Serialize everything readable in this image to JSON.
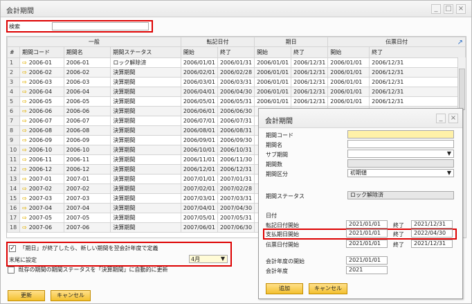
{
  "window": {
    "title": "会計期間",
    "minimize": "_",
    "maximize": "□",
    "close": "×"
  },
  "search": {
    "label": "検索",
    "value": ""
  },
  "grid": {
    "groups": [
      "一般",
      "転記日付",
      "期日",
      "伝票日付"
    ],
    "headers": [
      "#",
      "期間コード",
      "期間名",
      "期間ステータス",
      "開始",
      "終了",
      "開始",
      "終了",
      "開始",
      "終了"
    ],
    "rows": [
      [
        "1",
        "2006-01",
        "2006-01",
        "ロック解除済",
        "2006/01/01",
        "2006/01/31",
        "2006/01/01",
        "2006/12/31",
        "2006/01/01",
        "2006/12/31"
      ],
      [
        "2",
        "2006-02",
        "2006-02",
        "決算期間",
        "2006/02/01",
        "2006/02/28",
        "2006/01/01",
        "2006/12/31",
        "2006/01/01",
        "2006/12/31"
      ],
      [
        "3",
        "2006-03",
        "2006-03",
        "決算期間",
        "2006/03/01",
        "2006/03/31",
        "2006/01/01",
        "2006/12/31",
        "2006/01/01",
        "2006/12/31"
      ],
      [
        "4",
        "2006-04",
        "2006-04",
        "決算期間",
        "2006/04/01",
        "2006/04/30",
        "2006/01/01",
        "2006/12/31",
        "2006/01/01",
        "2006/12/31"
      ],
      [
        "5",
        "2006-05",
        "2006-05",
        "決算期間",
        "2006/05/01",
        "2006/05/31",
        "2006/01/01",
        "2006/12/31",
        "2006/01/01",
        "2006/12/31"
      ],
      [
        "6",
        "2006-06",
        "2006-06",
        "決算期間",
        "2006/06/01",
        "2006/06/30",
        "",
        "",
        "",
        ""
      ],
      [
        "7",
        "2006-07",
        "2006-07",
        "決算期間",
        "2006/07/01",
        "2006/07/31",
        "",
        "",
        "",
        ""
      ],
      [
        "8",
        "2006-08",
        "2006-08",
        "決算期間",
        "2006/08/01",
        "2006/08/31",
        "",
        "",
        "",
        ""
      ],
      [
        "9",
        "2006-09",
        "2006-09",
        "決算期間",
        "2006/09/01",
        "2006/09/30",
        "",
        "",
        "",
        ""
      ],
      [
        "10",
        "2006-10",
        "2006-10",
        "決算期間",
        "2006/10/01",
        "2006/10/31",
        "",
        "",
        "",
        ""
      ],
      [
        "11",
        "2006-11",
        "2006-11",
        "決算期間",
        "2006/11/01",
        "2006/11/30",
        "",
        "",
        "",
        ""
      ],
      [
        "12",
        "2006-12",
        "2006-12",
        "決算期間",
        "2006/12/01",
        "2006/12/31",
        "",
        "",
        "",
        ""
      ],
      [
        "13",
        "2007-01",
        "2007-01",
        "決算期間",
        "2007/01/01",
        "2007/01/31",
        "",
        "",
        "",
        ""
      ],
      [
        "14",
        "2007-02",
        "2007-02",
        "決算期間",
        "2007/02/01",
        "2007/02/28",
        "",
        "",
        "",
        ""
      ],
      [
        "15",
        "2007-03",
        "2007-03",
        "決算期間",
        "2007/03/01",
        "2007/03/31",
        "",
        "",
        "",
        ""
      ],
      [
        "16",
        "2007-04",
        "2007-04",
        "決算期間",
        "2007/04/01",
        "2007/04/30",
        "",
        "",
        "",
        ""
      ],
      [
        "17",
        "2007-05",
        "2007-05",
        "決算期間",
        "2007/05/01",
        "2007/05/31",
        "",
        "",
        "",
        ""
      ],
      [
        "18",
        "2007-06",
        "2007-06",
        "決算期間",
        "2007/06/01",
        "2007/06/30",
        "",
        "",
        "",
        ""
      ]
    ]
  },
  "options": {
    "opt1": "「期日」が終了したら、新しい期間を翌会計年度で定義",
    "opt2_label": "末尾に設定",
    "opt2_value": "4月",
    "opt3": "既存の期間の期間ステータスを「決算期間」に自動的に更新"
  },
  "buttons": {
    "update": "更新",
    "cancel": "キャンセル"
  },
  "dialog": {
    "title": "会計期間",
    "minimize": "_",
    "close": "×",
    "labels": {
      "code": "期間コード",
      "name": "期間名",
      "subperiod": "サブ期間",
      "count": "期間数",
      "category": "期間区分",
      "status": "期間ステータス",
      "dates": "日付",
      "posting": "転記日付開始",
      "due": "支払期日開始",
      "doc": "伝票日付開始",
      "fy_start": "会計年度の開始",
      "fy": "会計年度",
      "end": "終了"
    },
    "values": {
      "category": "初期値",
      "status": "ロック解除済",
      "posting_from": "2021/01/01",
      "posting_to": "2021/12/31",
      "due_from": "2021/01/01",
      "due_to": "2022/04/30",
      "doc_from": "2021/01/01",
      "doc_to": "2021/12/31",
      "fy_start": "2021/01/01",
      "fy": "2021"
    },
    "buttons": {
      "add": "追加",
      "cancel": "キャンセル"
    }
  }
}
